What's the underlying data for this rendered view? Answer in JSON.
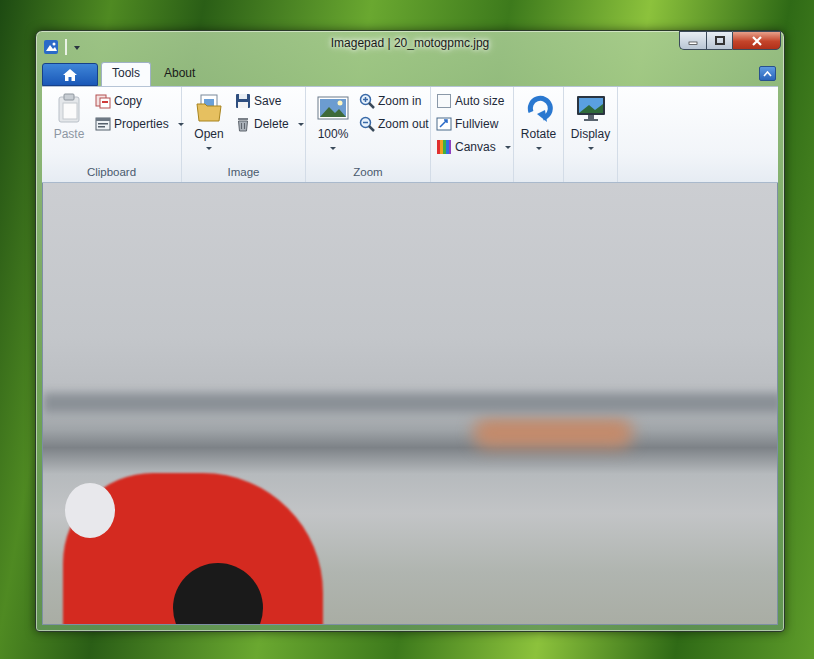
{
  "window": {
    "title": "Imagepad | 20_motogpmc.jpg"
  },
  "tabs": [
    {
      "label": "Tools",
      "selected": true
    },
    {
      "label": "About",
      "selected": false
    }
  ],
  "ribbon": {
    "groups": [
      {
        "label": "Clipboard",
        "items": [
          {
            "label": "Paste",
            "kind": "large",
            "disabled": true
          },
          {
            "label": "Copy",
            "kind": "small",
            "disabled": false
          },
          {
            "label": "Properties",
            "kind": "small-dropdown",
            "disabled": false
          }
        ]
      },
      {
        "label": "Image",
        "items": [
          {
            "label": "Open",
            "kind": "large-dropdown",
            "disabled": false
          },
          {
            "label": "Save",
            "kind": "small",
            "disabled": false
          },
          {
            "label": "Delete",
            "kind": "small-dropdown",
            "disabled": false
          }
        ]
      },
      {
        "label": "Zoom",
        "items": [
          {
            "label": "100%",
            "kind": "large-dropdown",
            "disabled": false
          },
          {
            "label": "Zoom in",
            "kind": "small",
            "disabled": false
          },
          {
            "label": "Zoom out",
            "kind": "small",
            "disabled": false
          }
        ]
      },
      {
        "items": [
          {
            "label": "Auto size",
            "kind": "checkbox",
            "checked": false,
            "disabled": false
          },
          {
            "label": "Fullview",
            "kind": "small",
            "disabled": false
          },
          {
            "label": "Canvas",
            "kind": "small-dropdown",
            "disabled": false
          }
        ]
      },
      {
        "items": [
          {
            "label": "Rotate",
            "kind": "large-dropdown",
            "disabled": false
          }
        ]
      },
      {
        "items": [
          {
            "label": "Display",
            "kind": "large-dropdown",
            "disabled": false
          }
        ]
      }
    ]
  }
}
